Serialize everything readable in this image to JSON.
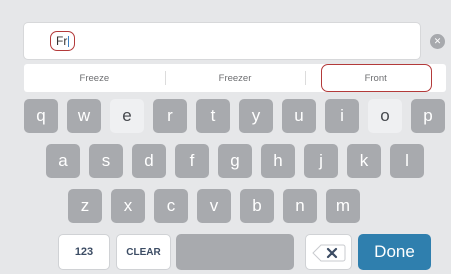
{
  "input": {
    "value": "Fr"
  },
  "suggestions": [
    "Freeze",
    "Freezer",
    "Front"
  ],
  "keyboard": {
    "row1": [
      "q",
      "w",
      "e",
      "r",
      "t",
      "y",
      "u",
      "i",
      "o",
      "p"
    ],
    "row2": [
      "a",
      "s",
      "d",
      "f",
      "g",
      "h",
      "j",
      "k",
      "l"
    ],
    "row3": [
      "z",
      "x",
      "c",
      "v",
      "b",
      "n",
      "m"
    ],
    "numbers_label": "123",
    "clear_label": "CLEAR",
    "done_label": "Done"
  }
}
